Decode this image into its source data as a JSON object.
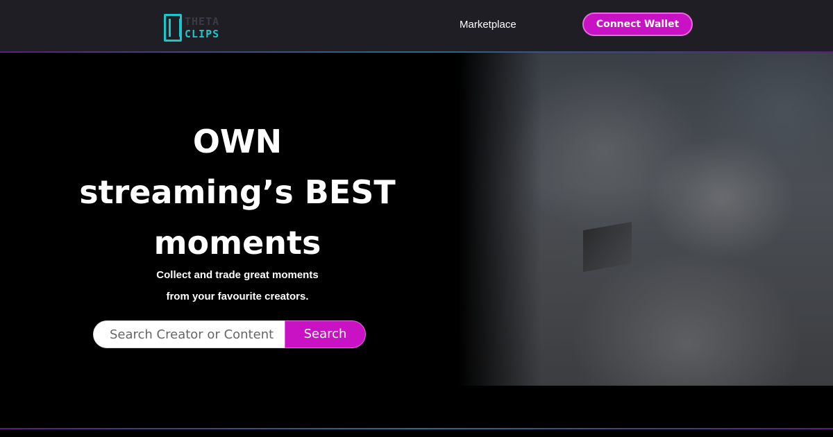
{
  "header": {
    "logo": {
      "line1": "THETA",
      "line2": "CLIPS"
    },
    "nav": {
      "marketplace_label": "Marketplace"
    },
    "connect_wallet_label": "Connect Wallet"
  },
  "hero": {
    "title_line1": "OWN",
    "title_line2": "streaming’s BEST",
    "title_line3": "moments",
    "subtitle_line1": "Collect and trade great moments",
    "subtitle_line2": "from your favourite creators.",
    "search": {
      "placeholder": "Search Creator or Content",
      "value": "",
      "button_label": "Search"
    }
  },
  "colors": {
    "accent": "#c812c4",
    "logo": "#19c6c9",
    "header_bg": "#1f1e24",
    "page_bg": "#000000"
  }
}
